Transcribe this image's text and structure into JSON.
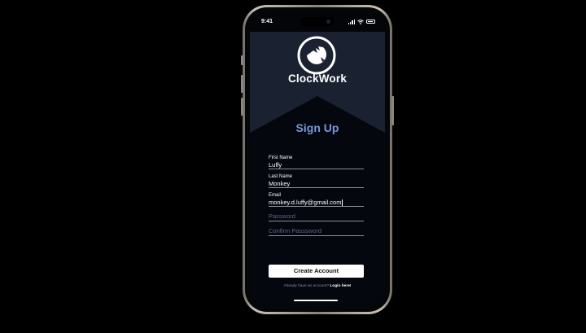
{
  "status_bar": {
    "time": "9:41",
    "icons": [
      "signal-icon",
      "wifi-icon",
      "battery-icon"
    ]
  },
  "app": {
    "name": "ClockWork",
    "logo_icon": "clock-fox-logo-icon"
  },
  "form": {
    "title": "Sign Up",
    "fields": [
      {
        "label": "First Name",
        "value": "Luffy"
      },
      {
        "label": "Last Name",
        "value": "Monkey"
      },
      {
        "label": "Email",
        "value": "monkey.d.luffy@gmail.com"
      },
      {
        "placeholder": "Password"
      },
      {
        "placeholder": "Confirm Passsword"
      }
    ],
    "submit_label": "Create Account",
    "login_prompt": "Already have an account?",
    "login_link": "Login here!"
  },
  "colors": {
    "background": "#000000",
    "header": "#1a2232",
    "screen": "#05070f",
    "accent": "#7a97d9",
    "placeholder": "#5c6784"
  }
}
